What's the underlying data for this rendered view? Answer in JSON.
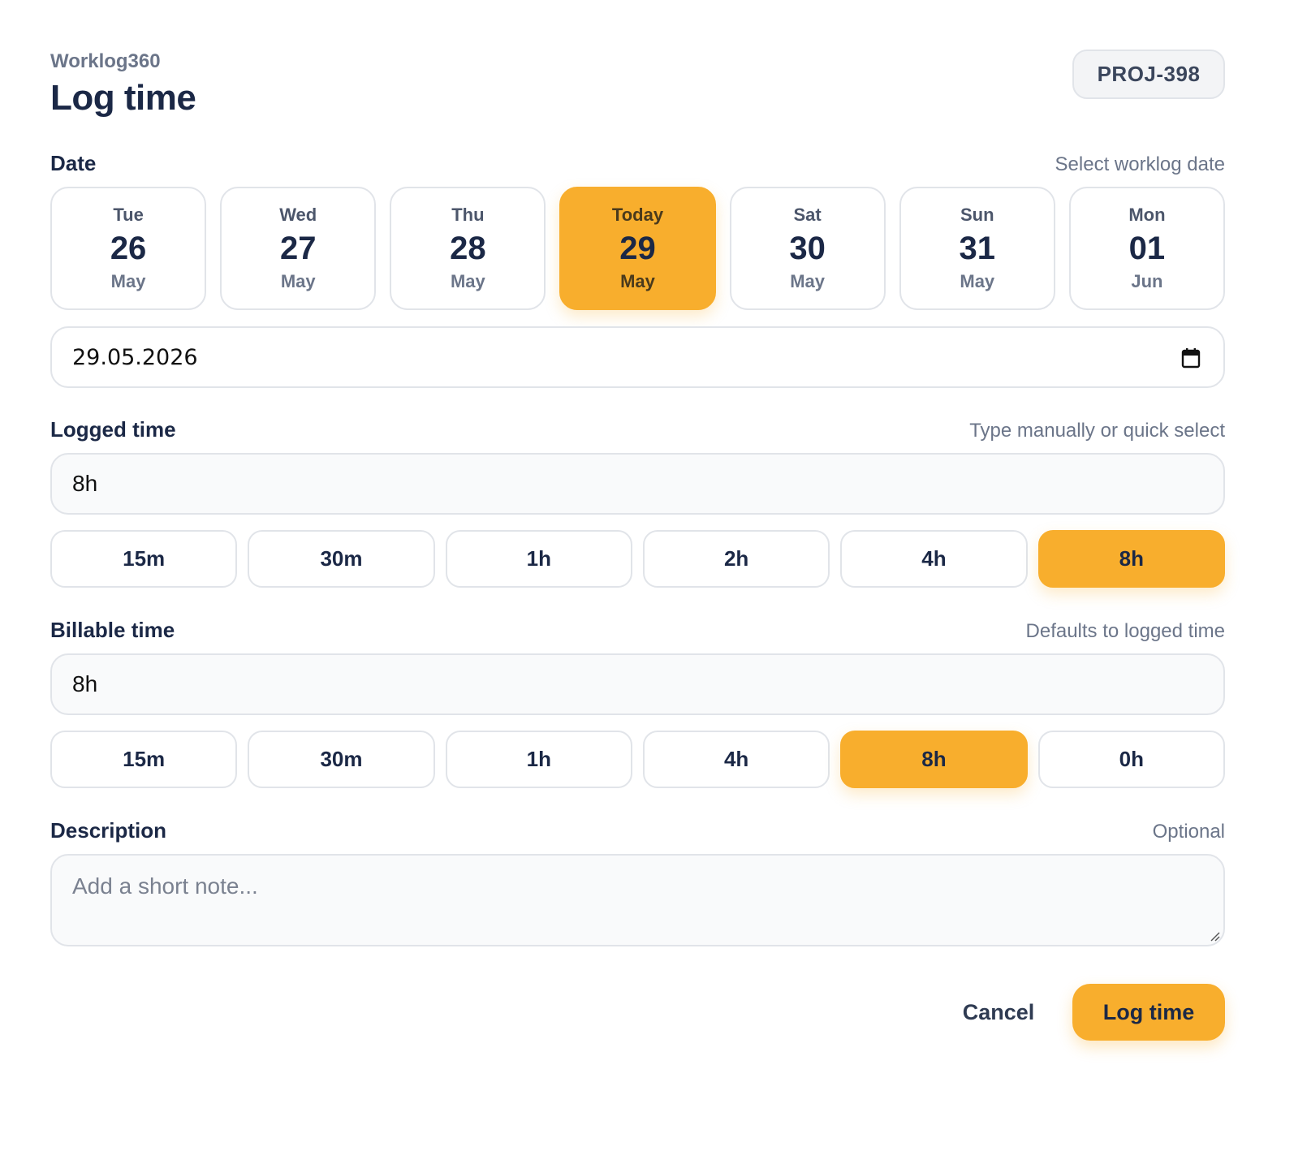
{
  "header": {
    "app_name": "Worklog360",
    "title": "Log time",
    "issue_key": "PROJ-398"
  },
  "date_section": {
    "label": "Date",
    "hint": "Select worklog date",
    "days": [
      {
        "weekday": "Tue",
        "day": "26",
        "month": "May",
        "selected": false
      },
      {
        "weekday": "Wed",
        "day": "27",
        "month": "May",
        "selected": false
      },
      {
        "weekday": "Thu",
        "day": "28",
        "month": "May",
        "selected": false
      },
      {
        "weekday": "Today",
        "day": "29",
        "month": "May",
        "selected": true
      },
      {
        "weekday": "Sat",
        "day": "30",
        "month": "May",
        "selected": false
      },
      {
        "weekday": "Sun",
        "day": "31",
        "month": "May",
        "selected": false
      },
      {
        "weekday": "Mon",
        "day": "01",
        "month": "Jun",
        "selected": false
      }
    ],
    "date_value": "29.05.2026",
    "calendar_icon": "calendar-icon"
  },
  "logged_section": {
    "label": "Logged time",
    "hint": "Type manually or quick select",
    "value": "8h",
    "options": [
      {
        "label": "15m",
        "selected": false
      },
      {
        "label": "30m",
        "selected": false
      },
      {
        "label": "1h",
        "selected": false
      },
      {
        "label": "2h",
        "selected": false
      },
      {
        "label": "4h",
        "selected": false
      },
      {
        "label": "8h",
        "selected": true
      }
    ]
  },
  "billable_section": {
    "label": "Billable time",
    "hint": "Defaults to logged time",
    "value": "8h",
    "options": [
      {
        "label": "15m",
        "selected": false
      },
      {
        "label": "30m",
        "selected": false
      },
      {
        "label": "1h",
        "selected": false
      },
      {
        "label": "4h",
        "selected": false
      },
      {
        "label": "8h",
        "selected": true
      },
      {
        "label": "0h",
        "selected": false
      }
    ]
  },
  "description_section": {
    "label": "Description",
    "hint": "Optional",
    "placeholder": "Add a short note..."
  },
  "actions": {
    "cancel_label": "Cancel",
    "submit_label": "Log time"
  },
  "colors": {
    "accent": "#f8ae2d",
    "text_primary": "#1b2846",
    "text_muted": "#6b7589",
    "border": "#e1e4e9"
  }
}
